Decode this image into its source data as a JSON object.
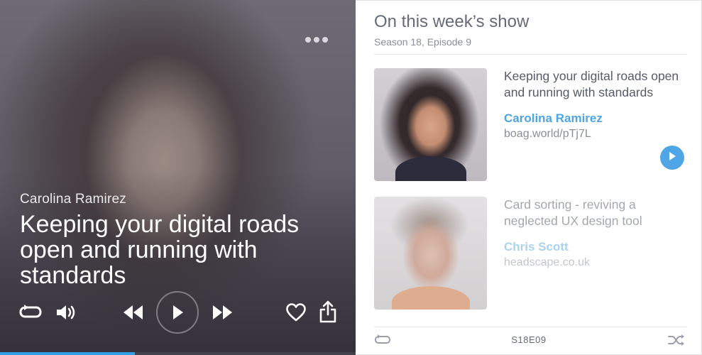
{
  "player": {
    "artist": "Carolina Ramirez",
    "title": "Keeping your digital roads open and running with standards",
    "progress_fraction": 0.38,
    "icons": {
      "more": "more-dots-icon",
      "repeat": "repeat-icon",
      "volume": "volume-icon",
      "rewind": "rewind-icon",
      "play": "play-icon",
      "forward": "fast-forward-icon",
      "like": "heart-icon",
      "share": "share-icon"
    }
  },
  "panel": {
    "title": "On this week’s show",
    "subtitle": "Season 18, Episode 9",
    "episodes": [
      {
        "title": "Keeping your digital roads open and running with standards",
        "guest": "Carolina Ramirez",
        "link": "boag.world/pTj7L"
      },
      {
        "title": "Card sorting - reviving a neglected UX design tool",
        "guest": "Chris Scott",
        "link": "headscape.co.uk"
      }
    ],
    "footer": {
      "code": "S18E09"
    }
  },
  "colors": {
    "accent": "#4da5e3",
    "progress": "#2f9fe6",
    "heading": "#646a78",
    "muted": "#8a8f99"
  }
}
